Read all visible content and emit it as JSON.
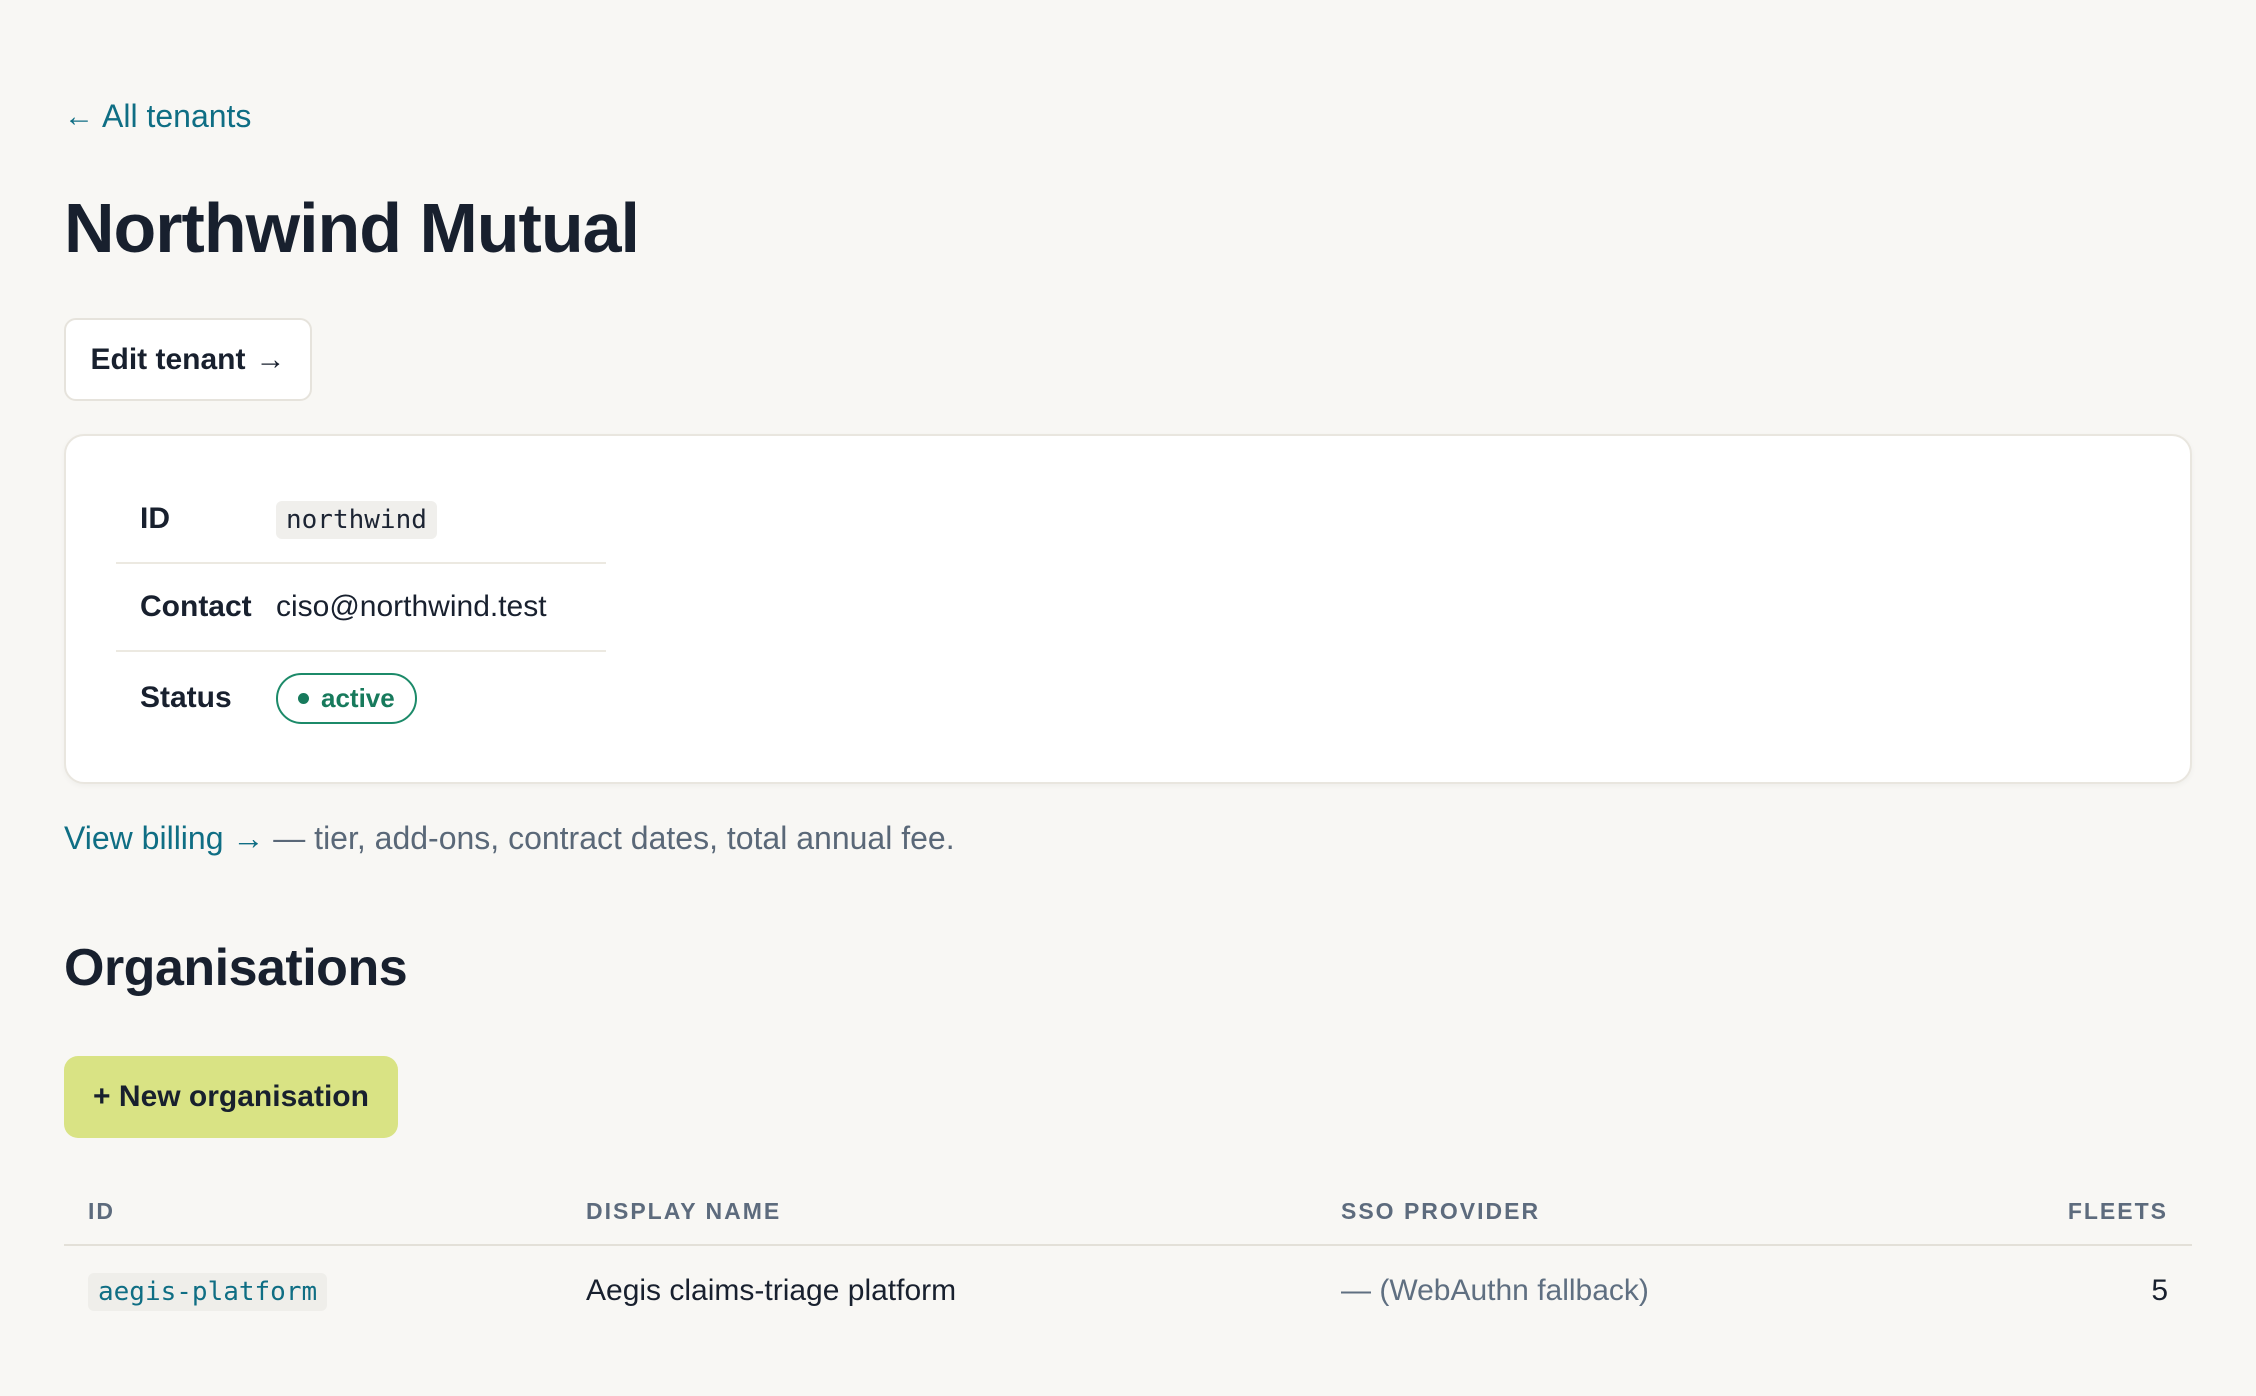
{
  "nav": {
    "back_arrow": "←",
    "back_label": "All tenants"
  },
  "page": {
    "title": "Northwind Mutual"
  },
  "actions": {
    "edit_label": "Edit tenant",
    "edit_arrow": "→"
  },
  "details": {
    "id_label": "ID",
    "id_value": "northwind",
    "contact_label": "Contact",
    "contact_value": "ciso@northwind.test",
    "status_label": "Status",
    "status_value": "active",
    "status_color": "#177a5c"
  },
  "billing": {
    "link_label": "View billing →",
    "description": " — tier, add-ons, contract dates, total annual fee."
  },
  "organisations": {
    "heading": "Organisations",
    "new_button_label": "+ New organisation",
    "new_button_color": "#d9e384",
    "columns": [
      "ID",
      "DISPLAY NAME",
      "SSO PROVIDER",
      "FLEETS"
    ],
    "rows": [
      {
        "id": "aegis-platform",
        "display_name": "Aegis claims-triage platform",
        "sso_provider": "— (WebAuthn fallback)",
        "fleets": "5"
      }
    ]
  },
  "colors": {
    "link": "#0f6e84",
    "background": "#f8f7f4"
  }
}
